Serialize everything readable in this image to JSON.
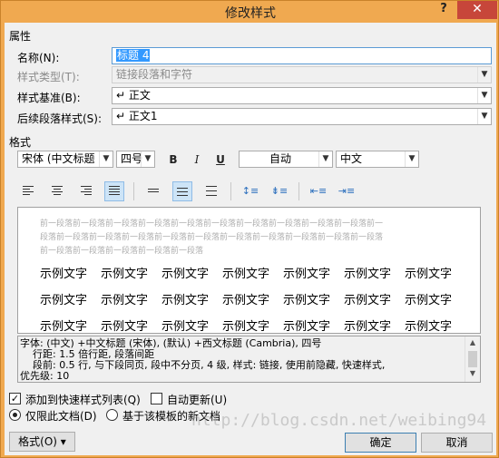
{
  "window": {
    "title": "修改样式",
    "help_label": "?",
    "close_label": "✕"
  },
  "properties": {
    "section_label": "属性",
    "name": {
      "label": "名称(N):",
      "value": "标题 4"
    },
    "style_type": {
      "label": "样式类型(T):",
      "value": "链接段落和字符"
    },
    "based_on": {
      "label": "样式基准(B):",
      "value": "↵ 正文"
    },
    "next_style": {
      "label": "后续段落样式(S):",
      "value": "↵ 正文1"
    }
  },
  "format": {
    "section_label": "格式",
    "font": "宋体 (中文标题",
    "size": "四号",
    "bold_label": "B",
    "italic_label": "I",
    "underline_label": "U",
    "color": "自动",
    "script": "中文"
  },
  "preview": {
    "previous_paragraph_lines": [
      "前一段落前一段落前一段落前一段落前一段落前一段落前一段落前一段落前一段落前一段落前一",
      "段落前一段落前一段落前一段落前一段落前一段落前一段落前一段落前一段落前一段落前一段落",
      "前一段落前一段落前一段落前一段落前一段落"
    ],
    "sample_text": "示例文字"
  },
  "description": {
    "line1": "字体: (中文) +中文标题 (宋体), (默认) +西文标题 (Cambria), 四号",
    "line2": "    行距: 1.5 倍行距, 段落间距",
    "line3": "    段前: 0.5 行, 与下段同页, 段中不分页, 4 级, 样式: 链接, 使用前隐藏, 快速样式,",
    "line4": "优先级: 10"
  },
  "options": {
    "add_to_quick_styles": "添加到快速样式列表(Q)",
    "auto_update": "自动更新(U)",
    "only_this_document": "仅限此文档(D)",
    "new_docs_based_on_template": "基于该模板的新文档"
  },
  "buttons": {
    "format": "格式(O) ▾",
    "ok": "确定",
    "cancel": "取消"
  },
  "watermark": "http://blog.csdn.net/weibing94",
  "colors": {
    "frame": "#f0a950",
    "close": "#c7463a",
    "selection": "#3399ff"
  }
}
